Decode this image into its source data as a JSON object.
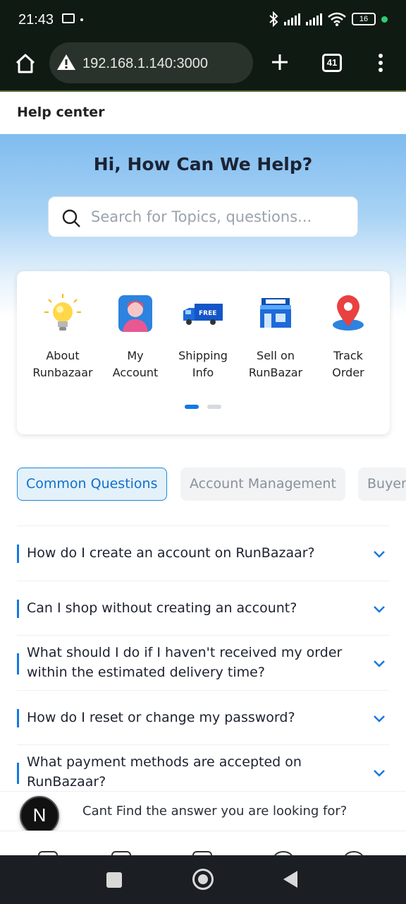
{
  "status_bar": {
    "time": "21:43",
    "battery": "16"
  },
  "browser": {
    "url": "192.168.1.140:3000",
    "tab_count": "41"
  },
  "page": {
    "title": "Help center"
  },
  "hero": {
    "heading": "Hi, How Can We Help?",
    "search_placeholder": "Search for Topics, questions..."
  },
  "categories": [
    {
      "label": "About\nRunbazaar",
      "icon": "lightbulb-icon"
    },
    {
      "label": "My\nAccount",
      "icon": "user-avatar-icon"
    },
    {
      "label": "Shipping\nInfo",
      "icon": "delivery-truck-icon"
    },
    {
      "label": "Sell on\nRunBazar",
      "icon": "storefront-icon"
    },
    {
      "label": "Track\nOrder",
      "icon": "location-pin-icon"
    }
  ],
  "carousel": {
    "pages": 2,
    "active": 0
  },
  "tabs": [
    {
      "label": "Common Questions",
      "active": true
    },
    {
      "label": "Account Management",
      "active": false
    },
    {
      "label": "Buyer",
      "active": false
    }
  ],
  "faq": [
    {
      "question": "How do I create an account on RunBazaar?"
    },
    {
      "question": "Can I shop without creating an account?"
    },
    {
      "question": "What should I do if I haven't received my order within the estimated delivery time?"
    },
    {
      "question": "How do I reset or change my password?"
    },
    {
      "question": "What payment methods are accepted on RunBazaar?"
    }
  ],
  "help_banner": {
    "avatar_letter": "N",
    "message": "Cant Find the answer you are looking for?"
  },
  "colors": {
    "accent": "#1578e0",
    "tab_active_text": "#1170c9",
    "status_bar_bg": "#0f1a12"
  }
}
